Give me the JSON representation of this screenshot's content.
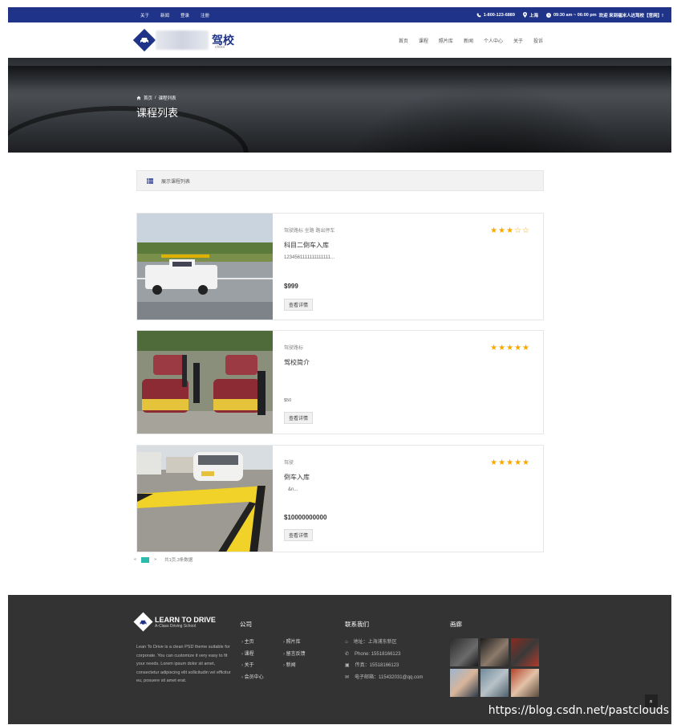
{
  "topbar": {
    "links": [
      "关于",
      "新闻",
      "登录",
      "注册"
    ],
    "phone": "1-800-123-6889",
    "city": "上海",
    "hours": "09:30 am ~ 06:00 pm",
    "welcome": "欢迎 来到福米人达驾校【官网】!"
  },
  "header": {
    "logo_text": "驾校",
    "logo_sub": "chool",
    "nav": [
      "首页",
      "课程",
      "照片库",
      "新闻",
      "个人中心",
      "关于",
      "投诉"
    ]
  },
  "hero": {
    "crumb_home": "首页",
    "crumb_sep": "/",
    "crumb_current": "课程列表",
    "title": "课程列表"
  },
  "notice": {
    "text": "展示课程列表"
  },
  "courses": [
    {
      "category": "驾驶路标 坐路 路出停车",
      "name": "科目二倒车入库",
      "desc": "1234561111111111111...",
      "price": "$999",
      "button": "查看详情",
      "rating": 3
    },
    {
      "category": "驾驶路标",
      "name": "驾校简介",
      "desc": "",
      "price": "$50",
      "button": "查看详情",
      "rating": 5
    },
    {
      "category": "驾驶",
      "name": "倒车入库",
      "desc": "&n...",
      "price": "$10000000000",
      "button": "查看详情",
      "rating": 5
    }
  ],
  "pager": {
    "prev": "«",
    "next": "»",
    "summary": "共1页,3条数据"
  },
  "footer": {
    "brand": "LEARN TO DRIVE",
    "brand_sub": "A-Class Driving School",
    "desc": "Lean To Drive is a clean PSD theme suitable for corporate. You can customize it very easy to fit your needs. Lorem ipsum dolor sit amet, consectetur adipiscing elit sollicitudin vel efficitur eu, posuere sit amet erat.",
    "col_company": "公司",
    "links_a": [
      "主页",
      "课程",
      "关于",
      "会员中心"
    ],
    "links_b": [
      "照片库",
      "留言反馈",
      "新闻"
    ],
    "col_contact": "联系我们",
    "contact": {
      "address": "地址：上海浦东新区",
      "phone": "Phone: 15518166123",
      "fax": "传真：15518166123",
      "email": "电子邮箱：115432031@qq.com"
    },
    "col_gallery": "画廊",
    "to_top": "»"
  },
  "watermark": "https://blog.csdn.net/pastclouds",
  "colors": {
    "brand": "#1f3389",
    "star": "#f7a800",
    "pager": "#2bbbad",
    "footer": "#333333"
  }
}
